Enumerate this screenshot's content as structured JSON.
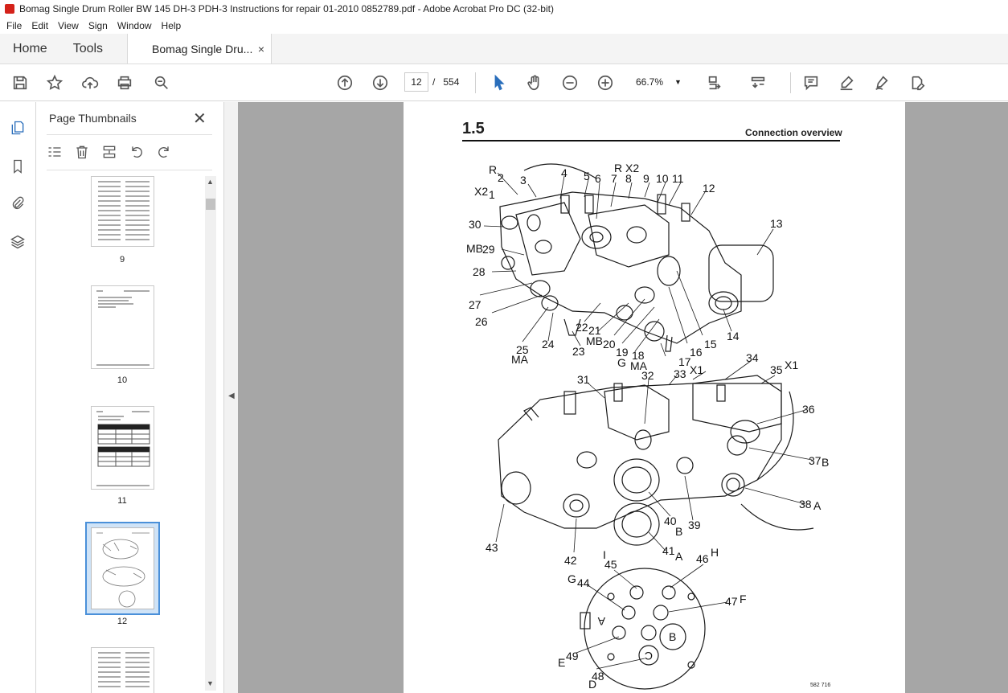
{
  "window": {
    "title": "Bomag Single Drum Roller BW 145 DH-3 PDH-3 Instructions for repair 01-2010 0852789.pdf - Adobe Acrobat Pro DC (32-bit)"
  },
  "menu": [
    "File",
    "Edit",
    "View",
    "Sign",
    "Window",
    "Help"
  ],
  "tabs": {
    "home": "Home",
    "tools": "Tools",
    "document": "Bomag Single Dru...",
    "close": "×"
  },
  "toolbar": {
    "current_page": "12",
    "page_separator": "/",
    "total_pages": "554",
    "zoom": "66.7%"
  },
  "thumbnails_panel": {
    "title": "Page Thumbnails",
    "close": "✕",
    "pages": [
      {
        "label": "9"
      },
      {
        "label": "10"
      },
      {
        "label": "11"
      },
      {
        "label": "12",
        "selected": true
      }
    ]
  },
  "document_page": {
    "section": "1.5",
    "heading": "Connection overview",
    "figure_id": "582 716",
    "callouts": [
      "R",
      "2",
      "3",
      "4",
      "5",
      "6",
      "R",
      "X2",
      "7",
      "8",
      "9",
      "10",
      "11",
      "X2",
      "1",
      "12",
      "30",
      "13",
      "MB",
      "29",
      "28",
      "27",
      "26",
      "22",
      "21",
      "MB",
      "20",
      "19",
      "18",
      "15",
      "16",
      "14",
      "25",
      "MA",
      "24",
      "23",
      "G",
      "MA",
      "17",
      "X1",
      "31",
      "32",
      "33",
      "34",
      "35",
      "X1",
      "36",
      "37",
      "B",
      "38",
      "A",
      "40",
      "B",
      "39",
      "41",
      "A",
      "43",
      "42",
      "I",
      "45",
      "46",
      "H",
      "G",
      "44",
      "47",
      "F",
      "A",
      "E",
      "49",
      "48",
      "D",
      "B",
      "C"
    ]
  }
}
